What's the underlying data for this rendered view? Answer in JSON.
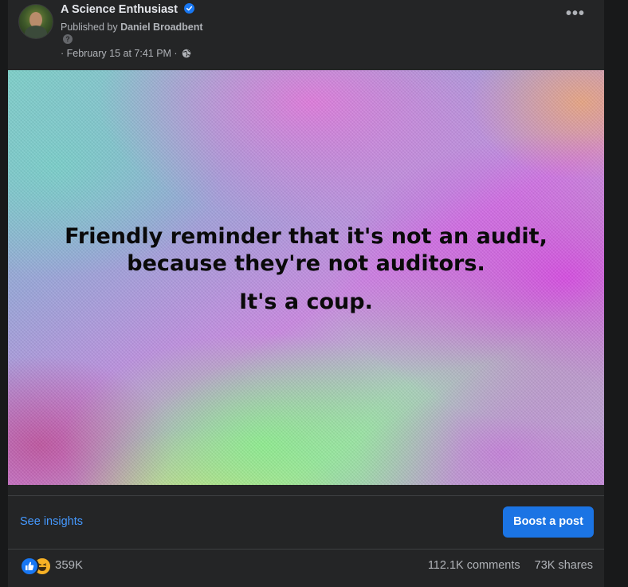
{
  "post": {
    "page_name": "A Science Enthusiast",
    "published_prefix": "Published by",
    "author": "Daniel Broadbent",
    "timestamp": "· February 15 at 7:41 PM ·",
    "more_label": "•••"
  },
  "image": {
    "line1": "Friendly reminder that it's not an audit,",
    "line2": "because they're not auditors.",
    "line3": "It's a coup."
  },
  "actions": {
    "see_insights": "See insights",
    "boost": "Boost a post"
  },
  "engagement": {
    "reactions": "359K",
    "comments": "112.1K comments",
    "shares": "73K shares"
  },
  "icons": [
    "verified-badge-icon",
    "help-icon",
    "globe-icon",
    "more-options-icon",
    "like-reaction-icon",
    "haha-reaction-icon"
  ],
  "colors": {
    "accent": "#1b74e4",
    "link": "#4599ff",
    "card": "#242526",
    "background": "#18191a"
  }
}
